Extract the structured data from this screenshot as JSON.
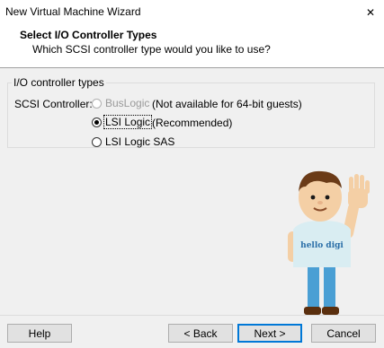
{
  "window": {
    "title": "New Virtual Machine Wizard",
    "close_symbol": "✕"
  },
  "header": {
    "title": "Select I/O Controller Types",
    "subtitle": "Which SCSI controller type would you like to use?"
  },
  "group": {
    "legend": "I/O controller types",
    "scsi_label": "SCSI Controller:",
    "options": [
      {
        "label": "BusLogic",
        "note": "(Not available for 64-bit guests)",
        "selected": false,
        "enabled": false
      },
      {
        "label": "LSI Logic",
        "note": "(Recommended)",
        "selected": true,
        "enabled": true
      },
      {
        "label": "LSI Logic SAS",
        "note": "",
        "selected": false,
        "enabled": true
      }
    ]
  },
  "mascot": {
    "shirt_text": "hello digi"
  },
  "footer": {
    "help": "Help",
    "back": "< Back",
    "next": "Next >",
    "cancel": "Cancel"
  },
  "colors": {
    "accent": "#0078d7",
    "body_bg": "#f0f0f0",
    "shirt": "#d9edf2",
    "hair": "#6b3b17",
    "pants": "#4a9fd4"
  }
}
